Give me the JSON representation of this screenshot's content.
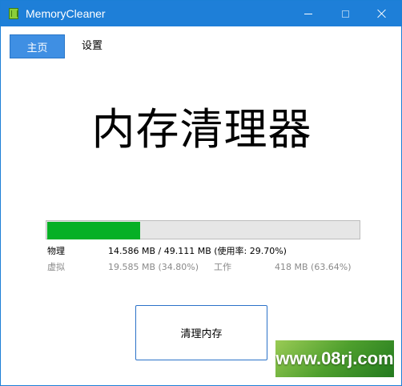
{
  "window": {
    "title": "MemoryCleaner",
    "app_icon": "memory-chip-icon",
    "controls": [
      "minimize-icon",
      "maximize-icon",
      "close-icon"
    ]
  },
  "nav": {
    "tabs": [
      {
        "label": "主页",
        "active": true
      },
      {
        "label": "设置",
        "active": false
      }
    ]
  },
  "main": {
    "title": "内存清理器"
  },
  "progress": {
    "value": 29.7,
    "fill_color": "#06b025"
  },
  "stats": {
    "physical": {
      "label": "物理",
      "value": "14.586 MB / 49.111 MB (使用率: 29.70%)"
    },
    "virtual": {
      "label": "虚拟",
      "value": "19.585 MB (34.80%)"
    },
    "working_set": {
      "label": "工作",
      "value": "418 MB (63.64%)"
    }
  },
  "actions": {
    "clean_label": "清理内存"
  },
  "watermark": {
    "text": "www.08rj.com"
  },
  "colors": {
    "titlebar": "#1e7fd8",
    "active_tab": "#3f8fe3",
    "button_border": "#2b72c8",
    "progress_track": "#e6e6e6"
  }
}
